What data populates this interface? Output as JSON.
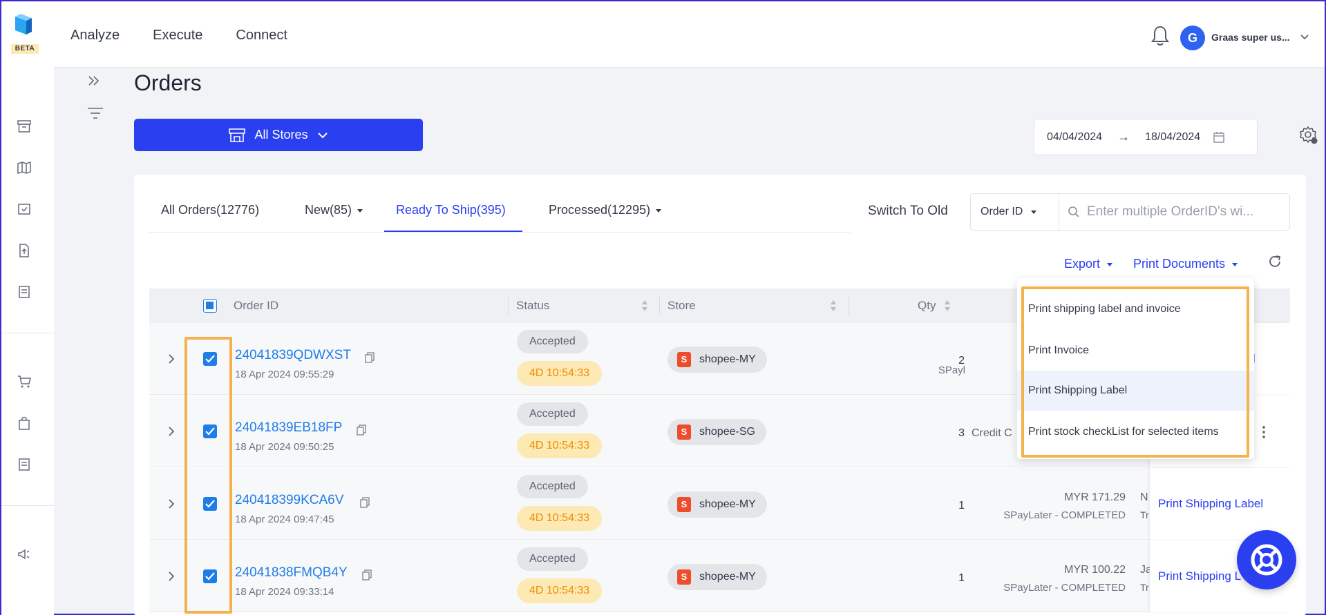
{
  "topbar": {
    "beta": "BETA",
    "nav": [
      "Analyze",
      "Execute",
      "Connect"
    ],
    "avatar_initial": "G",
    "username": "Graas super us..."
  },
  "page": {
    "title": "Orders",
    "stores_label": "All Stores",
    "date_from": "04/04/2024",
    "date_arrow": "→",
    "date_to": "18/04/2024"
  },
  "tabs": [
    {
      "label": "All Orders(12776)"
    },
    {
      "label": "New(85)"
    },
    {
      "label": "Ready To Ship(395)"
    },
    {
      "label": "Processed(12295)"
    }
  ],
  "switch_old": "Switch To Old",
  "search": {
    "select_label": "Order ID",
    "placeholder": "Enter multiple OrderID's wi..."
  },
  "toolbar": {
    "export_label": "Export",
    "print_label": "Print Documents"
  },
  "table": {
    "headers": {
      "order_id": "Order ID",
      "status": "Status",
      "store": "Store",
      "qty": "Qty"
    },
    "rows": [
      {
        "order_id": "24041839QDWXST",
        "date": "18 Apr 2024 09:55:29",
        "status": "Accepted",
        "timer": "4D 10:54:33",
        "store": "shopee-MY",
        "qty": "2",
        "amount": "",
        "payment": "SPayl",
        "action": "bel"
      },
      {
        "order_id": "24041839EB18FP",
        "date": "18 Apr 2024 09:50:25",
        "status": "Accepted",
        "timer": "4D 10:54:33",
        "store": "shopee-SG",
        "qty": "3",
        "amount": "",
        "payment": "Credit C",
        "action": ""
      },
      {
        "order_id": "240418399KCA6V",
        "date": "18 Apr 2024 09:47:45",
        "status": "Accepted",
        "timer": "4D 10:54:33",
        "store": "shopee-MY",
        "qty": "1",
        "amount": "MYR 171.29",
        "payment": "SPayLater - COMPLETED",
        "trunc1": "N",
        "trunc2": "Tr",
        "action": "Print Shipping Label"
      },
      {
        "order_id": "24041838FMQB4Y",
        "date": "18 Apr 2024 09:33:14",
        "status": "Accepted",
        "timer": "4D 10:54:33",
        "store": "shopee-MY",
        "qty": "1",
        "amount": "MYR 100.22",
        "payment": "SPayLater - COMPLETED",
        "trunc1": "Ja",
        "trunc2": "Tr",
        "action": "Print Shipping L"
      }
    ]
  },
  "print_menu": [
    "Print shipping label and invoice",
    "Print Invoice",
    "Print Shipping Label",
    "Print stock checkList for selected items"
  ],
  "colors": {
    "primary": "#2a3ff0",
    "link": "#1f7de8",
    "highlight": "#f5b14b",
    "timer_bg": "#fde9b4",
    "timer_text": "#f08c00"
  }
}
